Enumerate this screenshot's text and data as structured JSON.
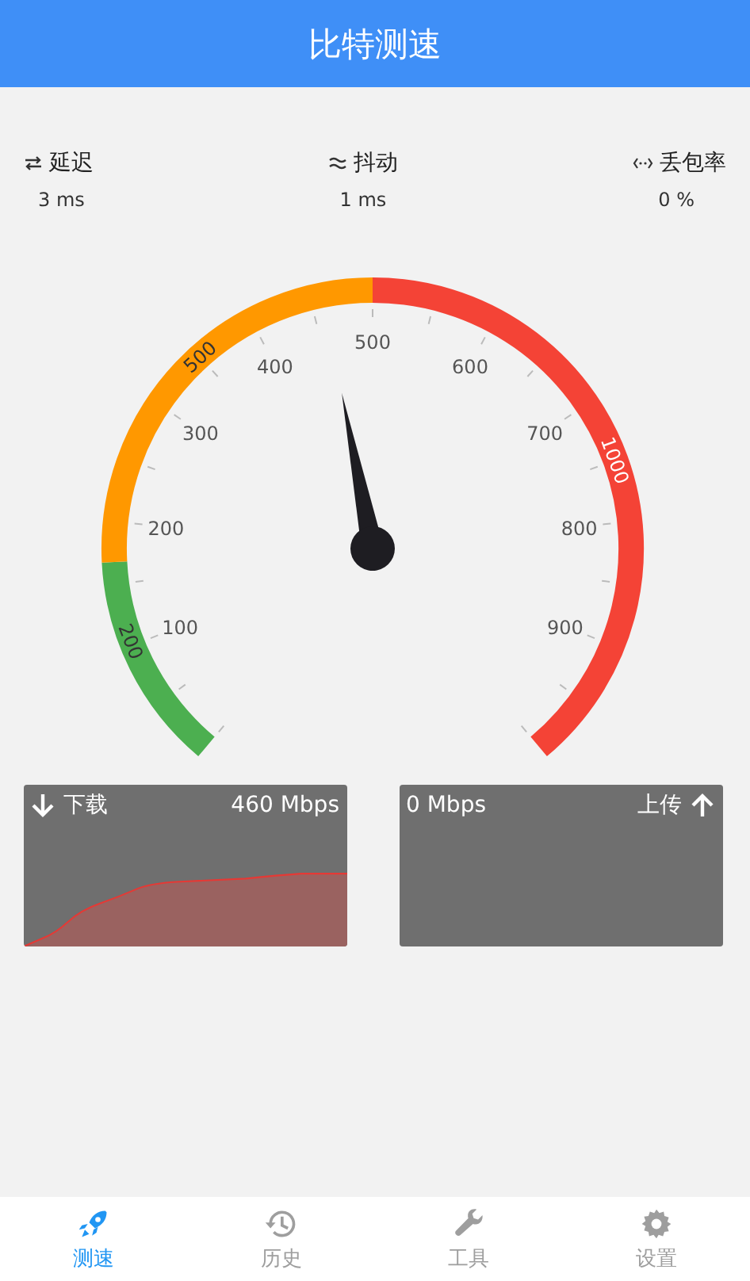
{
  "app_bar": {
    "title": "比特测速"
  },
  "stats": [
    {
      "kind": "latency",
      "label": "延迟",
      "value": "3 ms"
    },
    {
      "kind": "jitter",
      "label": "抖动",
      "value": "1 ms"
    },
    {
      "kind": "loss",
      "label": "丢包率",
      "value": "0 %"
    }
  ],
  "gauge": {
    "scale_labels": [
      "100",
      "200",
      "300",
      "400",
      "500",
      "600",
      "700",
      "800",
      "900"
    ],
    "band_labels": [
      "200",
      "500",
      "1000"
    ]
  },
  "panels": [
    {
      "kind": "download",
      "label": "下载",
      "reading": "460 Mbps"
    },
    {
      "kind": "upload",
      "label": "上传",
      "reading": "0 Mbps"
    }
  ],
  "nav": [
    {
      "kind": "speed",
      "label": "测速",
      "selected": true
    },
    {
      "kind": "history",
      "label": "历史",
      "selected": false
    },
    {
      "kind": "tools",
      "label": "工具",
      "selected": false
    },
    {
      "kind": "settings",
      "label": "设置",
      "selected": false
    }
  ]
}
